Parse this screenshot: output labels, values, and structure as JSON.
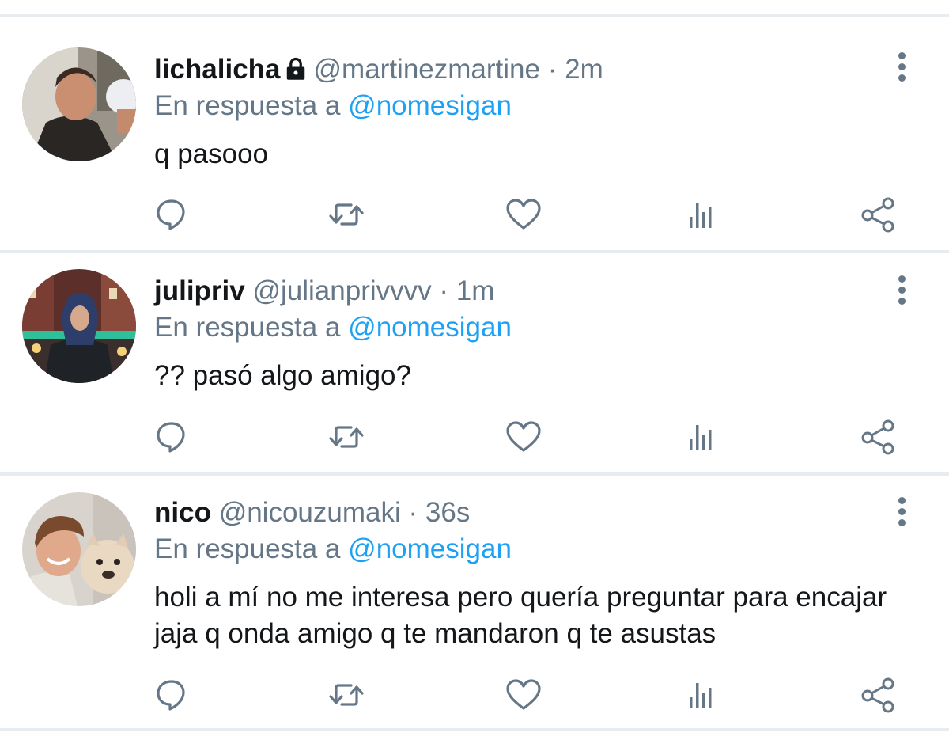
{
  "tweets": [
    {
      "name": "lichalicha",
      "handle": "@martinezmartine",
      "separator": "·",
      "time": "2m",
      "locked": true,
      "reply_prefix": "En respuesta a",
      "reply_to": "@nomesigan",
      "text": "q pasooo"
    },
    {
      "name": "julipriv",
      "handle": "@julianprivvvv",
      "separator": "·",
      "time": "1m",
      "locked": false,
      "reply_prefix": "En respuesta a",
      "reply_to": "@nomesigan",
      "text": "?? pasó algo amigo?"
    },
    {
      "name": "nico",
      "handle": "@nicouzumaki",
      "separator": "·",
      "time": "36s",
      "locked": false,
      "reply_prefix": "En respuesta a",
      "reply_to": "@nomesigan",
      "text": "holi a mí no me interesa pero quería preguntar para encajar jaja q onda amigo q te mandaron q te asustas"
    }
  ],
  "action_icons": [
    "reply-icon",
    "retweet-icon",
    "like-icon",
    "analytics-icon",
    "share-icon"
  ],
  "colors": {
    "name": "#14171a",
    "secondary": "#657786",
    "mention": "#1da1f2",
    "divider": "#e6ecf0"
  }
}
